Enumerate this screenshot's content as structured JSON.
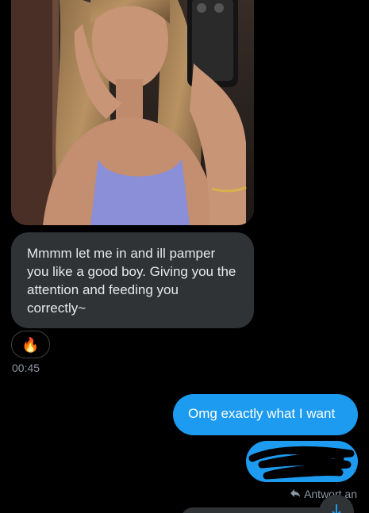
{
  "messages": {
    "received": {
      "text": "Mmmm let me in and ill pamper you like a good boy. Giving you the attention and feeding you correctly~",
      "reaction_emoji": "🔥",
      "time": "00:45"
    },
    "sent": [
      {
        "text": "Omg exactly what I want"
      }
    ],
    "reply_label": "Antwort an"
  },
  "icons": {
    "reply": "reply-arrow-icon",
    "scroll_down": "arrow-down-icon"
  },
  "colors": {
    "background": "#000000",
    "incoming_bubble": "#2f3336",
    "outgoing_bubble": "#1d9bf0",
    "secondary_text": "#8b98a5"
  }
}
